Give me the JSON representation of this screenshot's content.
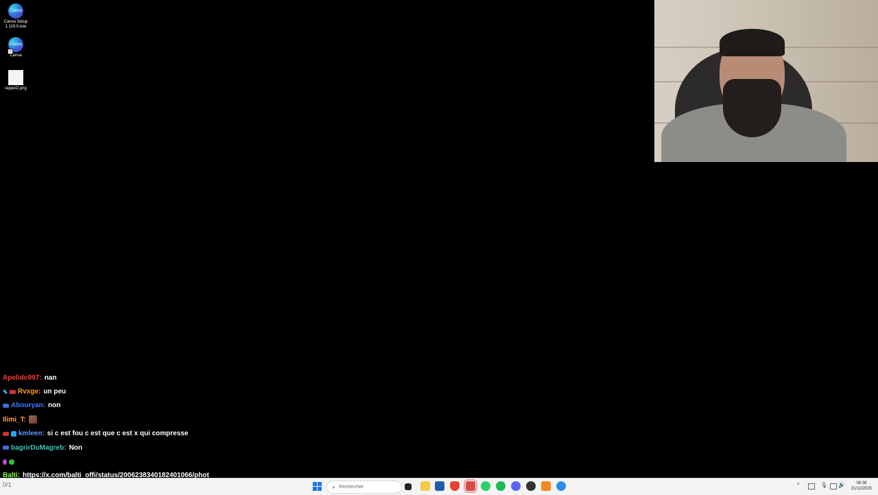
{
  "desktop": {
    "icons": [
      {
        "label_line1": "Canva Setup",
        "label_line2": "1.119.0.exe",
        "icon": "canva-icon",
        "glyph": "Canva"
      },
      {
        "label_line1": "Canva",
        "icon": "canva-icon",
        "glyph": "Canva"
      },
      {
        "label_line1": "rappel2.png",
        "icon": "image-file-icon"
      }
    ]
  },
  "chat": {
    "messages": [
      {
        "user": "Apelido997:",
        "user_color": "#ff3b3b",
        "text": "nan"
      },
      {
        "user": "Rvxge:",
        "user_color": "#ff9f1a",
        "text": "un peu"
      },
      {
        "user": "Abouryan:",
        "user_color": "#3b7bff",
        "text": "non"
      },
      {
        "user": "Ilimi_T:",
        "user_color": "#ff9f5a",
        "text": ""
      },
      {
        "user": "kmleen:",
        "user_color": "#5a9cff",
        "text": "si c est fou c est que c est x qui compresse"
      },
      {
        "user": "bagrirDuMagreb:",
        "user_color": "#36c9b0",
        "text": "Non"
      },
      {
        "user": "",
        "user_color": "#ffffff",
        "text": ""
      },
      {
        "user": "Balti:",
        "user_color": "#7dff3b",
        "text": "https://x.com/balti_offi/status/2006238340182401066/phot"
      }
    ]
  },
  "taskbar": {
    "left_text": "0/1",
    "search_placeholder": "Rechercher",
    "time": "06:38",
    "date": "31/12/2025",
    "colors": {
      "background": "#f3f3f3",
      "accent": "#1a73e8"
    }
  }
}
